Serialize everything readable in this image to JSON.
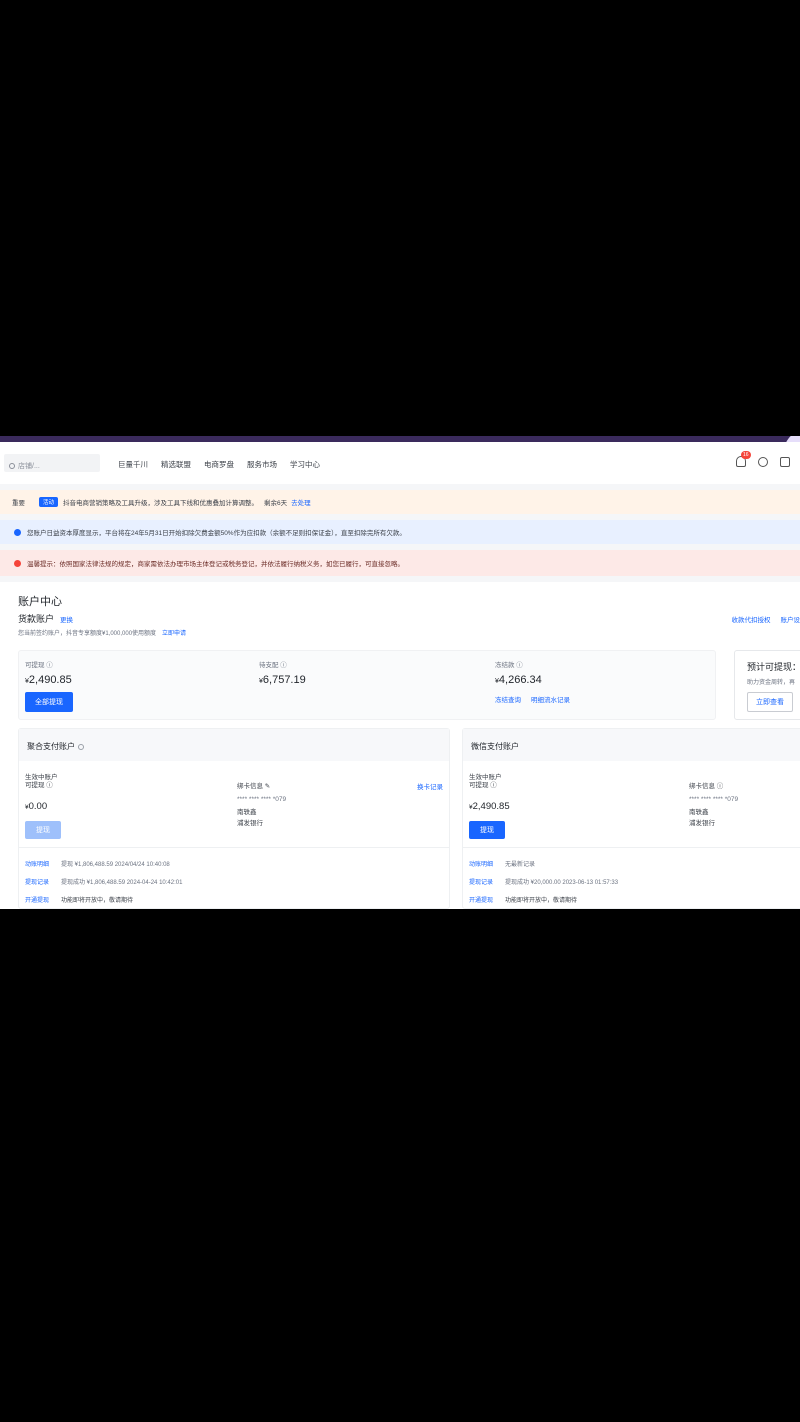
{
  "nav": {
    "search_placeholder": "店铺/...",
    "items": [
      "巨量千川",
      "精选联盟",
      "电商罗盘",
      "服务市场",
      "学习中心"
    ],
    "notification_count": "16"
  },
  "notices": {
    "n1": {
      "label": "重要",
      "tag": "活动",
      "text": "抖音电商营销策略及工具升级，涉及工具下线和优惠叠加计算调整。",
      "extra": "剩余6天",
      "link": "去处理"
    },
    "n2": {
      "text": "您账户日益资本厚度显示，平台将在24年5月31日开始扣除欠费金额50%作为应扣款（余额不足则扣保证金），直至扣除完所有欠款。"
    },
    "n3": {
      "text": "温馨提示：依照国家法律法规的规定，商家需依法办理市场主体登记或税务登记，并依法履行纳税义务，如您已履行，可直接忽略。"
    }
  },
  "main": {
    "title": "账户中心",
    "sub_title": "货款账户",
    "change_link": "更换",
    "note": "您当前签约账户，抖音专享额度¥1,000,000使用额度",
    "note_link": "立即申请",
    "top_links": [
      "收款代扣授权",
      "账户设"
    ]
  },
  "balances": {
    "b1": {
      "label": "可提现 ⓘ",
      "currency": "¥",
      "value": "2,490.85",
      "button": "全部提现"
    },
    "b2": {
      "label": "待支配 ⓘ",
      "currency": "¥",
      "value": "6,757.19"
    },
    "b3": {
      "label": "冻结款 ⓘ",
      "currency": "¥",
      "value": "4,266.34",
      "links": [
        "冻结查询",
        "明细流水记录"
      ]
    }
  },
  "side_card": {
    "title": "预计可提现：",
    "desc": "助力资金周转，再",
    "button": "立即查看"
  },
  "accounts": {
    "a1": {
      "header": "聚合支付账户",
      "label1": "生效中账户",
      "label2": "可提现 ⓘ",
      "currency": "¥",
      "amount": "0.00",
      "button": "提现",
      "card_title": "绑卡信息 ✎",
      "card_number": "**** **** **** *079",
      "card_holder": "南轶鑫",
      "card_bank": "浦发银行",
      "card_record": "换卡记录",
      "rows": [
        {
          "k": "动账明细",
          "v": "提现  ¥1,806,488.59  2024/04/24 10:40:08",
          "v2": ""
        },
        {
          "k": "提现记录",
          "v": "提现成功  ¥1,806,488.59  2024-04-24 10:42:01",
          "v2": ""
        },
        {
          "k": "开通提现",
          "v": "",
          "v2": "功能即将开放中，敬请期待"
        }
      ]
    },
    "a2": {
      "header": "微信支付账户",
      "label1": "生效中账户",
      "label2": "可提现 ⓘ",
      "currency": "¥",
      "amount": "2,490.85",
      "button": "提现",
      "card_title": "绑卡信息 ⓘ",
      "card_number": "**** **** **** *079",
      "card_holder": "南轶鑫",
      "card_bank": "浦发银行",
      "rows": [
        {
          "k": "动账明细",
          "v": "无最新记录",
          "v2": ""
        },
        {
          "k": "提现记录",
          "v": "提现成功  ¥20,000.00  2023-06-13 01:57:33",
          "v2": ""
        },
        {
          "k": "开通提现",
          "v": "",
          "v2": "功能即将开放中，敬请期待"
        }
      ]
    }
  }
}
